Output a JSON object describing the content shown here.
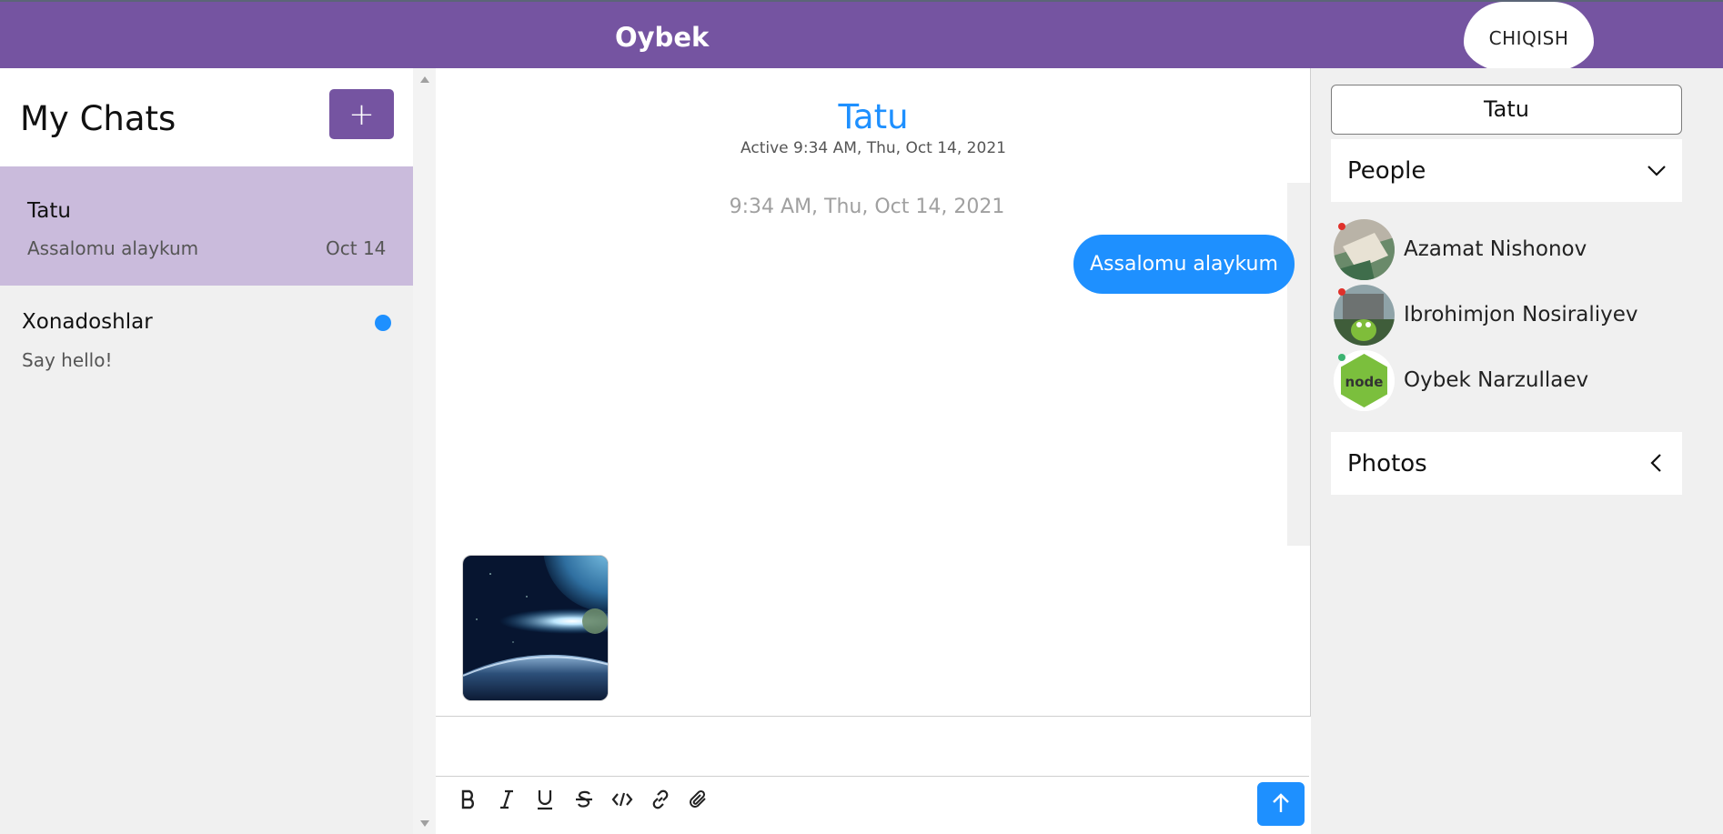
{
  "header": {
    "username": "Oybek",
    "logout_label": "CHIQISH",
    "accent_color": "#7554a1"
  },
  "chat_list": {
    "heading": "My Chats",
    "add_label": "+",
    "items": [
      {
        "name": "Tatu",
        "preview": "Assalomu alaykum",
        "date": "Oct 14",
        "active": true
      },
      {
        "name": "Xonadoshlar",
        "preview": "Say hello!",
        "unread": true
      }
    ]
  },
  "feed": {
    "title": "Tatu",
    "subtitle": "Active 9:34 AM, Thu, Oct 14, 2021",
    "timestamp": "9:34 AM, Thu, Oct 14, 2021",
    "message": "Assalomu alaykum",
    "bubble_color": "#1e90ff",
    "attachment": "space-photo",
    "toolbar": [
      "bold-icon",
      "italic-icon",
      "underline-icon",
      "strikethrough-icon",
      "code-icon",
      "link-icon",
      "attachment-icon"
    ],
    "send_icon": "arrow-up-icon"
  },
  "settings": {
    "title_value": "Tatu",
    "people_label": "People",
    "photos_label": "Photos",
    "people": [
      {
        "name": "Azamat Nishonov",
        "online": false
      },
      {
        "name": "Ibrohimjon Nosiraliyev",
        "online": false
      },
      {
        "name": "Oybek Narzullaev",
        "online": true
      }
    ]
  }
}
